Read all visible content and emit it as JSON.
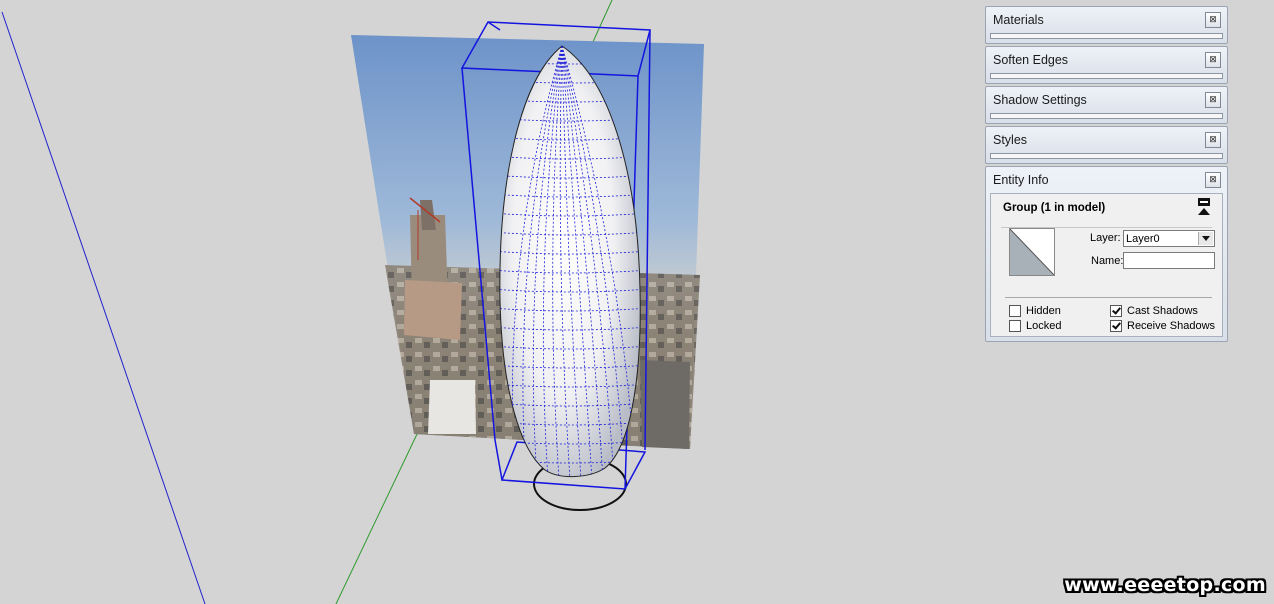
{
  "tray": {
    "panels": [
      {
        "title": "Materials"
      },
      {
        "title": "Soften Edges"
      },
      {
        "title": "Shadow Settings"
      },
      {
        "title": "Styles"
      }
    ],
    "close_glyph": "⊠",
    "entity_info": {
      "title": "Entity Info",
      "selection": "Group (1 in model)",
      "layer_label": "Layer:",
      "layer_value": "Layer0",
      "name_label": "Name:",
      "name_value": "",
      "checkboxes": {
        "hidden": {
          "label": "Hidden",
          "checked": false
        },
        "locked": {
          "label": "Locked",
          "checked": false
        },
        "cast_shadows": {
          "label": "Cast Shadows",
          "checked": true
        },
        "receive_shadows": {
          "label": "Receive Shadows",
          "checked": true
        }
      }
    }
  },
  "watermark": "www.eeeetop.com",
  "colors": {
    "background": "#d4d4d4",
    "selection_box": "#1414e0",
    "axis_blue": "#2222cc",
    "axis_green": "#2e9a2e",
    "swatch_fill": "#a8b0b8"
  },
  "icons": {
    "close": "close-icon",
    "collapse": "collapse-icon",
    "dropdown": "chevron-down-icon"
  }
}
